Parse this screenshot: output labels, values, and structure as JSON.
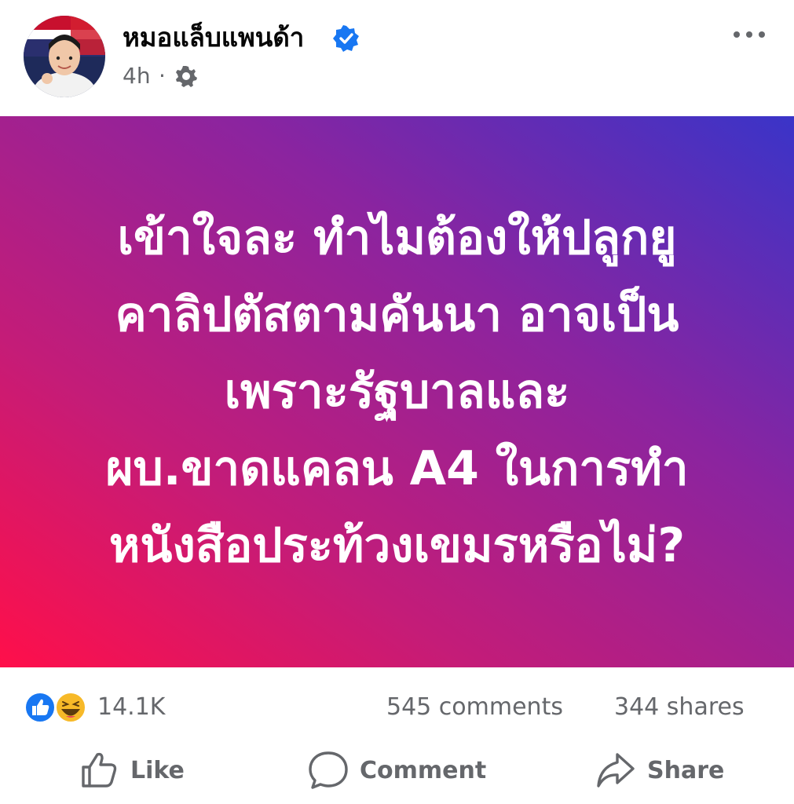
{
  "post": {
    "author_name": "หมอแล็บแพนด้า",
    "time": "4h",
    "separator": "·",
    "content_lines": [
      "เข้าใจละ ทำไมต้องให้ปลูกยู",
      "คาลิปตัสตามคันนา อาจเป็น",
      "เพราะรัฐบาลและ",
      "ผบ.ขาดแคลน A4 ในการทำ",
      "หนังสือประท้วงเขมรหรือไม่?"
    ],
    "background_colors": [
      "#ff0f4a",
      "#8a24a0",
      "#3a34c8"
    ]
  },
  "stats": {
    "reaction_count": "14.1K",
    "reactions": [
      "like-icon",
      "haha-icon"
    ],
    "comments": "545 comments",
    "shares": "344 shares"
  },
  "actions": {
    "like": "Like",
    "comment": "Comment",
    "share": "Share"
  },
  "colors": {
    "verified": "#1877f2",
    "secondary_text": "#65676b"
  }
}
